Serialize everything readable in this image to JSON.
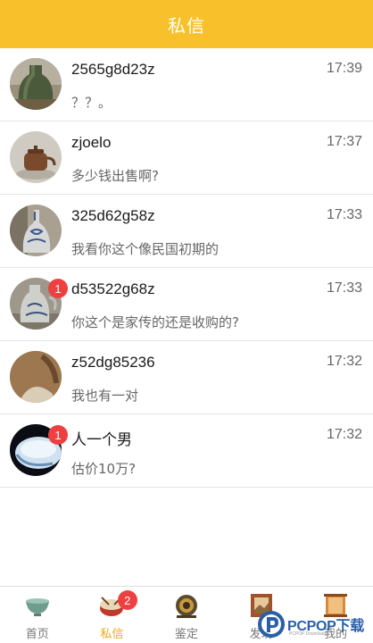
{
  "header": {
    "title": "私信"
  },
  "messages": [
    {
      "name": "2565g8d23z",
      "time": "17:39",
      "preview": "？？。",
      "badge": "",
      "avatar": "green-vase-avatar"
    },
    {
      "name": "zjoelo",
      "time": "17:37",
      "preview": "多少钱出售啊?",
      "badge": "",
      "avatar": "teapot-avatar"
    },
    {
      "name": "325d62g58z",
      "time": "17:33",
      "preview": "我看你这个像民国初期的",
      "badge": "",
      "avatar": "blue-white-vase-avatar"
    },
    {
      "name": "d53522g68z",
      "time": "17:33",
      "preview": "你这个是家传的还是收购的?",
      "badge": "1",
      "avatar": "blue-white-ewer-avatar"
    },
    {
      "name": "z52dg85236",
      "time": "17:32",
      "preview": "我也有一对",
      "badge": "",
      "avatar": "bronze-vase-avatar"
    },
    {
      "name": "人一个男",
      "time": "17:32",
      "preview": "估价10万?",
      "badge": "1",
      "avatar": "white-jade-bowl-avatar"
    }
  ],
  "bottom_nav": {
    "items": [
      {
        "label": "首页",
        "icon": "celadon-bowl-icon",
        "active": false,
        "badge": ""
      },
      {
        "label": "私信",
        "icon": "drum-icon",
        "active": true,
        "badge": "2"
      },
      {
        "label": "鉴定",
        "icon": "incense-burner-icon",
        "active": false,
        "badge": ""
      },
      {
        "label": "发现",
        "icon": "picture-frame-icon",
        "active": false,
        "badge": ""
      },
      {
        "label": "我的",
        "icon": "scroll-icon",
        "active": false,
        "badge": ""
      }
    ]
  },
  "watermark": {
    "text": "PCPOP下载",
    "sub": "PCPOP Downloads"
  },
  "colors": {
    "accent": "#f8c02a",
    "active_nav": "#f0a81c",
    "badge": "#ee4040"
  }
}
